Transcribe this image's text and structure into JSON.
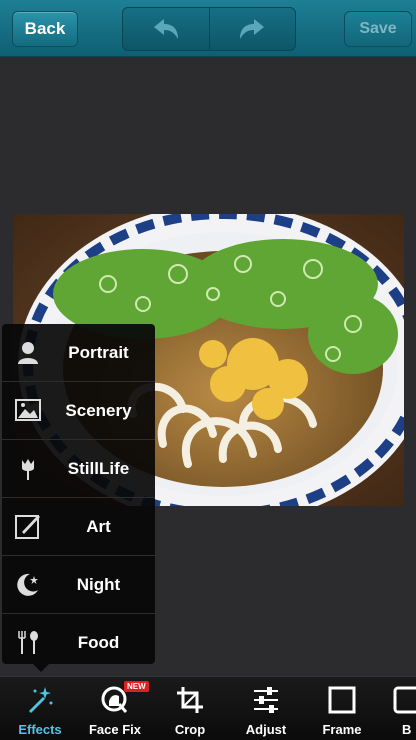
{
  "header": {
    "back_label": "Back",
    "save_label": "Save",
    "undo_icon": "undo-icon",
    "redo_icon": "redo-icon"
  },
  "effects_menu": {
    "items": [
      {
        "label": "Portrait",
        "icon": "portrait-icon"
      },
      {
        "label": "Scenery",
        "icon": "scenery-icon"
      },
      {
        "label": "StillLife",
        "icon": "flower-icon"
      },
      {
        "label": "Art",
        "icon": "brush-icon"
      },
      {
        "label": "Night",
        "icon": "moon-star-icon"
      },
      {
        "label": "Food",
        "icon": "fork-spoon-icon"
      }
    ]
  },
  "toolbar": {
    "tabs": [
      {
        "label": "Effects",
        "icon": "magic-wand-icon",
        "active": true
      },
      {
        "label": "Face Fix",
        "icon": "face-fix-icon",
        "badge": "NEW"
      },
      {
        "label": "Crop",
        "icon": "crop-icon"
      },
      {
        "label": "Adjust",
        "icon": "sliders-icon"
      },
      {
        "label": "Frame",
        "icon": "frame-icon"
      },
      {
        "label": "B",
        "icon": "partial-icon"
      }
    ]
  },
  "colors": {
    "header": "#1e7f95",
    "active_tab": "#4fc6e6",
    "background": "#2c2c2e"
  }
}
